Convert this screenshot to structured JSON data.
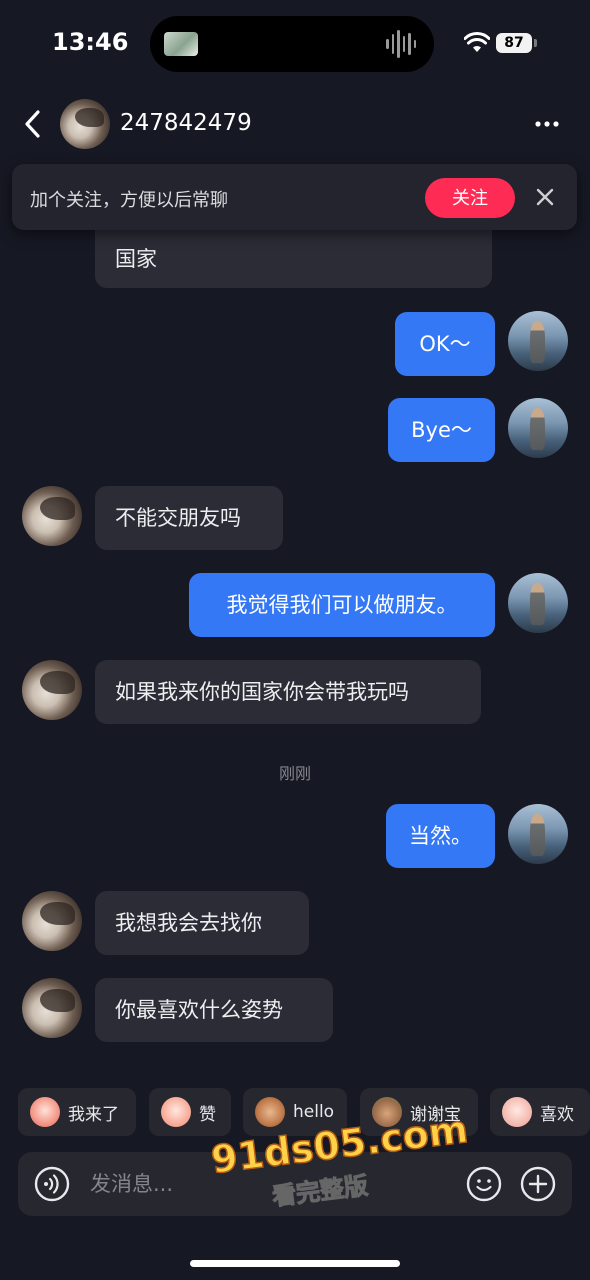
{
  "status_bar": {
    "time": "13:46",
    "battery": "87"
  },
  "header": {
    "contact_name": "247842479"
  },
  "follow_banner": {
    "text": "加个关注，方便以后常聊",
    "button_label": "关注"
  },
  "messages": [
    {
      "from": "them",
      "text": "国家"
    },
    {
      "from": "me",
      "text": "OK～"
    },
    {
      "from": "me",
      "text": "Bye～"
    },
    {
      "from": "them",
      "text": "不能交朋友吗"
    },
    {
      "from": "me",
      "text": "我觉得我们可以做朋友。"
    },
    {
      "from": "them",
      "text": "如果我来你的国家你会带我玩吗"
    },
    {
      "from": "me",
      "text": "当然。"
    },
    {
      "from": "them",
      "text": "我想我会去找你"
    },
    {
      "from": "them",
      "text": "你最喜欢什么姿势"
    }
  ],
  "timestamp": "刚刚",
  "quick_replies": [
    {
      "label": "我来了",
      "icon": "emoji-arrive-icon",
      "color": "#f08a7a"
    },
    {
      "label": "赞",
      "icon": "emoji-thumbs-icon",
      "color": "#f6a38f"
    },
    {
      "label": "hello",
      "icon": "emoji-monkey-icon",
      "color": "#c07a4a"
    },
    {
      "label": "谢谢宝",
      "icon": "emoji-thanks-icon",
      "color": "#9a6a4a"
    },
    {
      "label": "喜欢",
      "icon": "emoji-love-icon",
      "color": "#f2b4a8"
    }
  ],
  "input": {
    "placeholder": "发消息..."
  },
  "watermark": {
    "main": "91ds05.com",
    "sub": "看完整版"
  },
  "colors": {
    "background": "#161823",
    "outgoing_bubble": "#3478f6",
    "incoming_bubble": "#2b2c35",
    "follow_button": "#fe2c55"
  }
}
